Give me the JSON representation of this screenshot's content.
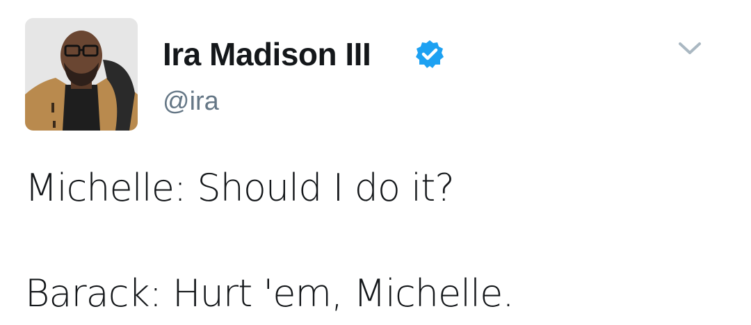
{
  "tweet": {
    "author": {
      "display_name": "Ira Madison III",
      "handle": "@ira",
      "verified": true
    },
    "lines": [
      "Michelle: Should I do it?",
      "Barack: Hurt 'em, Michelle."
    ]
  },
  "icons": {
    "verified": "verified-badge-icon",
    "caret": "chevron-down-icon"
  },
  "colors": {
    "verified_blue": "#1da1f2",
    "handle_gray": "#657786",
    "caret_gray": "#aab8c2",
    "text": "#14171a"
  }
}
